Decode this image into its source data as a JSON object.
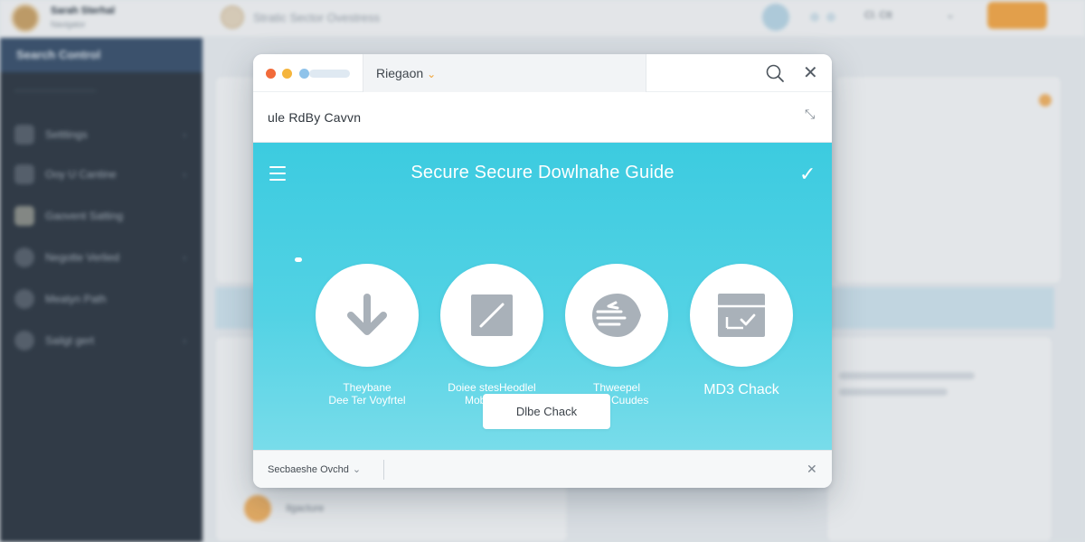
{
  "background": {
    "top_bar": {
      "user_name": "Sarah Sterhal",
      "user_subtitle": "Navigator",
      "search_text": "Stratic Sector Ovestress",
      "right_text": "Cl. Ctt"
    },
    "sidebar": {
      "header": "Search Control",
      "items": [
        "Setttings",
        "Ooy U Cantine",
        "Gaovent Satting",
        "Negotte Verlied",
        "Meatyn Path",
        "Sailgt gert"
      ]
    },
    "content": {
      "list_item": "Ilgacture"
    }
  },
  "dialog": {
    "title": "Riegaon",
    "address": "ule  RdBy Cavvn",
    "hero_title": "Secure Secure Dowlnahe Guide",
    "steps": [
      {
        "icon": "download-arrow-icon",
        "label_line1": "Theybane",
        "label_line2": "Dee Ter Voyfrtel"
      },
      {
        "icon": "document-slash-icon",
        "label_line1": "Doiee stesHeodlel",
        "label_line2": "Moble Uioy"
      },
      {
        "icon": "speed-hand-icon",
        "label_line1": "Thweepel",
        "label_line2": "Iouts Cuudes"
      },
      {
        "icon": "checked-box-icon",
        "label_line1": "MD3 Chack",
        "label_line2": ""
      }
    ],
    "check_button": "Dlbe Chack",
    "footer_text": "Secbaeshe Ovchd"
  },
  "colors": {
    "hero_top": "#3ccbe0",
    "hero_bottom": "#78dcea",
    "accent_orange": "#f0a43a",
    "step_icon": "#a9b1b9"
  }
}
